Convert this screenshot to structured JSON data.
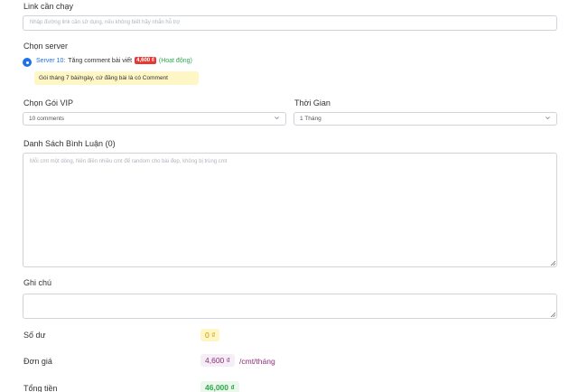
{
  "link": {
    "label": "Link cần chạy",
    "placeholder": "Nhập đường link cần sử dụng, nếu không biết hãy nhắn hỗ trợ"
  },
  "server": {
    "label": "Chọn server",
    "option": {
      "name": "Server 10:",
      "description": "Tăng comment bài viết",
      "price": "4,600 ₫",
      "status": "(Hoạt động)"
    },
    "note": "Gói tháng 7 bài/ngày, cứ đăng bài là có Comment"
  },
  "vip": {
    "label": "Chọn Gói VIP",
    "value": "10 comments"
  },
  "duration": {
    "label": "Thời Gian",
    "value": "1 Tháng"
  },
  "comments": {
    "label": "Danh Sách Bình Luận (0)",
    "placeholder": "Mỗi cmt một dòng, Nên điền nhiều cmt để random cho bài đẹp, không bị trùng cmt"
  },
  "note_field": {
    "label": "Ghi chú",
    "value": ""
  },
  "summary": {
    "balance_label": "Số dư",
    "balance_value": "0 ₫",
    "unit_price_label": "Đơn giá",
    "unit_price_value": "4,600 ₫",
    "unit_price_unit": "/cmt/tháng",
    "total_label": "Tổng tiền",
    "total_value": "46,000 ₫"
  },
  "colors": {
    "accent": "#1e73e8",
    "price_badge": "#e53935",
    "status": "#2ea84f",
    "note_bg": "#fff6c6"
  },
  "icons": {
    "select_arrow": "chevron-down-icon",
    "resize": "resize-grip-icon",
    "radio": "radio-selected-icon"
  }
}
